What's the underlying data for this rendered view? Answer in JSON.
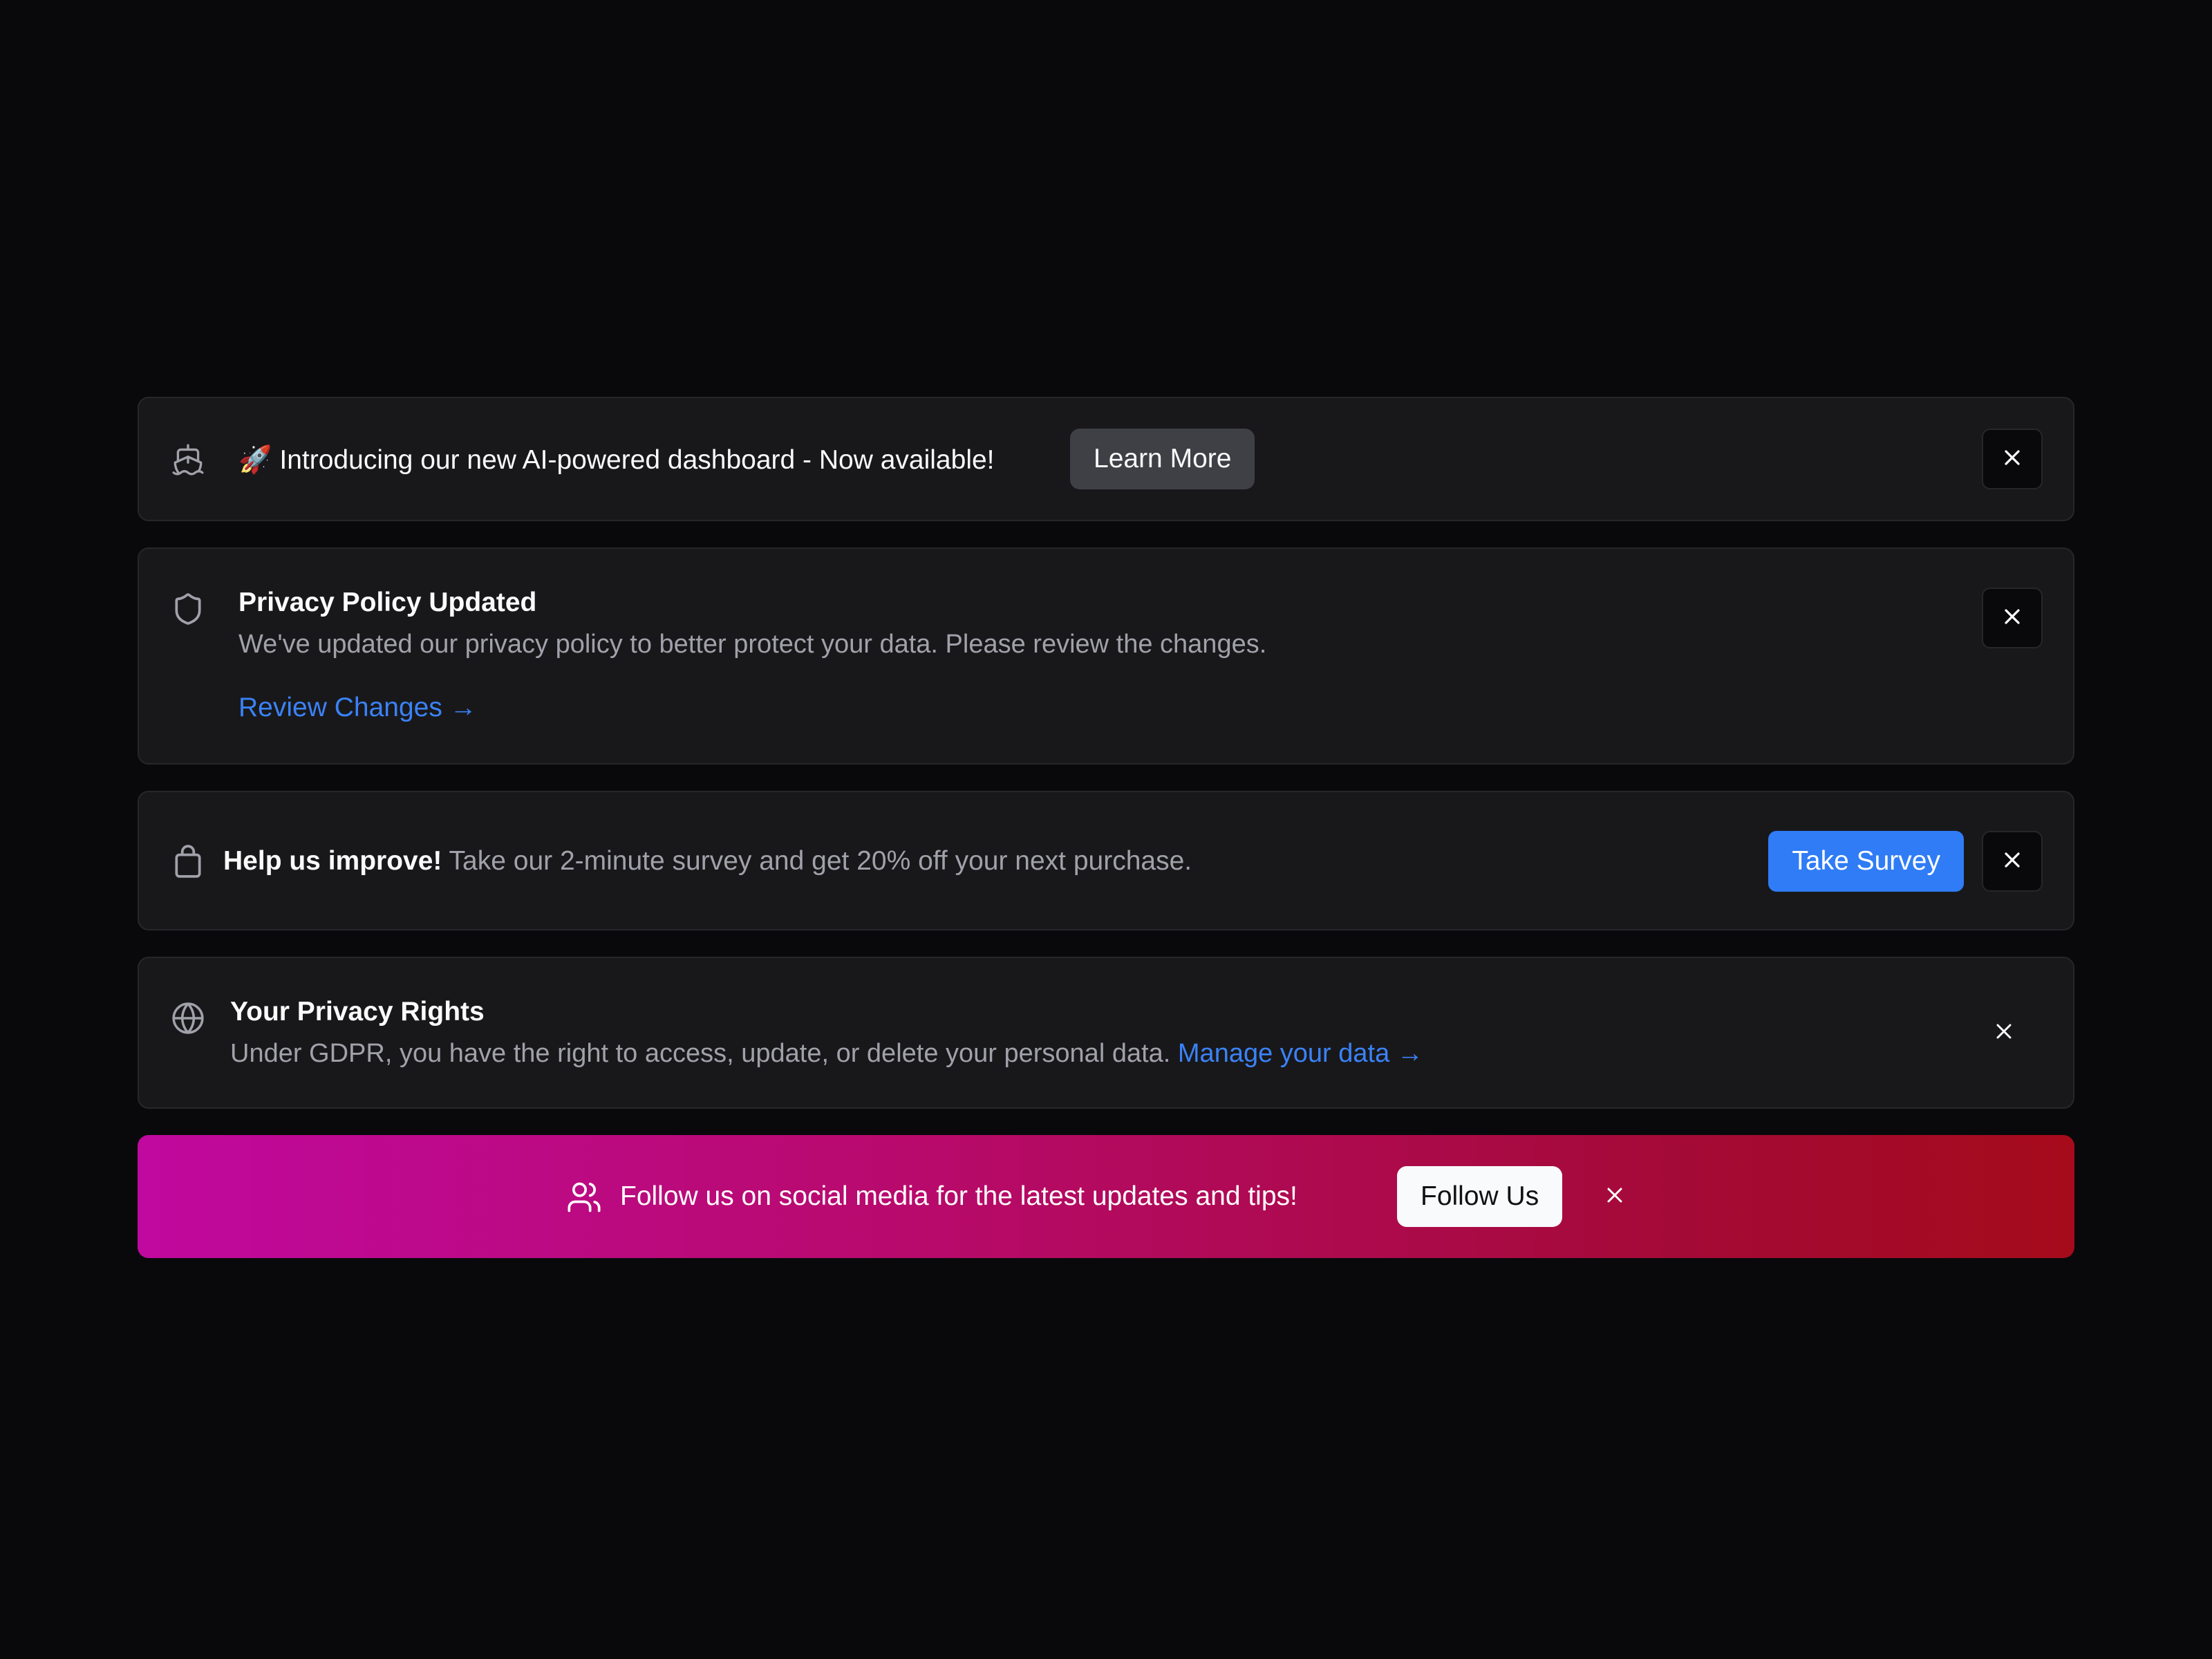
{
  "announcement": {
    "icon": "ship-icon",
    "message": "🚀 Introducing our new AI-powered dashboard - Now available!",
    "button_label": "Learn More",
    "close_icon": "close-icon"
  },
  "privacy_update": {
    "icon": "shield-icon",
    "title": "Privacy Policy Updated",
    "description": "We've updated our privacy policy to better protect your data. Please review the changes.",
    "link_label": "Review Changes →",
    "close_icon": "close-icon"
  },
  "survey": {
    "icon": "shopping-bag-icon",
    "headline": "Help us improve!",
    "message": "Take our 2-minute survey and get 20% off your next purchase.",
    "button_label": "Take Survey",
    "close_icon": "close-icon"
  },
  "privacy_rights": {
    "icon": "globe-icon",
    "title": "Your Privacy Rights",
    "description": "Under GDPR, you have the right to access, update, or delete your personal data.",
    "link_label": "Manage your data →",
    "close_icon": "close-icon"
  },
  "social": {
    "icon": "users-icon",
    "message": "Follow us on social media for the latest updates and tips!",
    "button_label": "Follow Us",
    "close_icon": "close-icon"
  },
  "colors": {
    "background": "#09090b",
    "card": "#18181b",
    "border": "#27272a",
    "link": "#3b82f6",
    "primary_button": "#2f7cf6",
    "gradient_start": "#c0099e",
    "gradient_end": "#a50b1a"
  }
}
